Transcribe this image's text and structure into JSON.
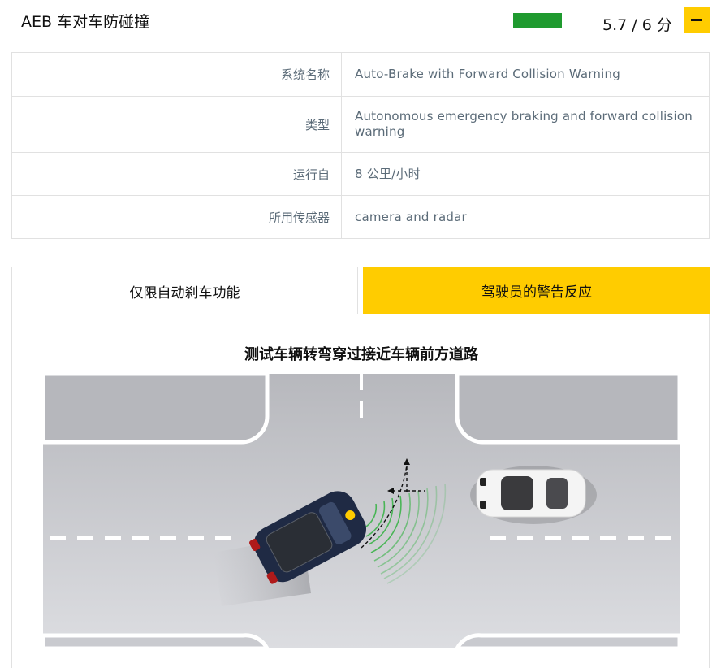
{
  "header": {
    "title": "AEB 车对车防碰撞",
    "score": "5.7 / 6 分",
    "score_fraction": 0.95,
    "score_color": "#1f9a2f",
    "collapse_icon": "minus-icon"
  },
  "specs": [
    {
      "label": "系统名称",
      "value": "Auto-Brake with Forward Collision Warning"
    },
    {
      "label": "类型",
      "value": "Autonomous emergency braking and forward collision warning"
    },
    {
      "label": "运行自",
      "value": "8 公里/小时"
    },
    {
      "label": "所用传感器",
      "value": "camera and radar"
    }
  ],
  "tabs": [
    {
      "label": "仅限自动刹车功能",
      "active": false
    },
    {
      "label": "驾驶员的警告反应",
      "active": true
    }
  ],
  "scenario": {
    "title": "测试车辆转弯穿过接近车辆前方道路"
  },
  "colors": {
    "accent": "#ffcc00",
    "road": "#bdbec3",
    "sensor_waves": "#3cb34a"
  }
}
